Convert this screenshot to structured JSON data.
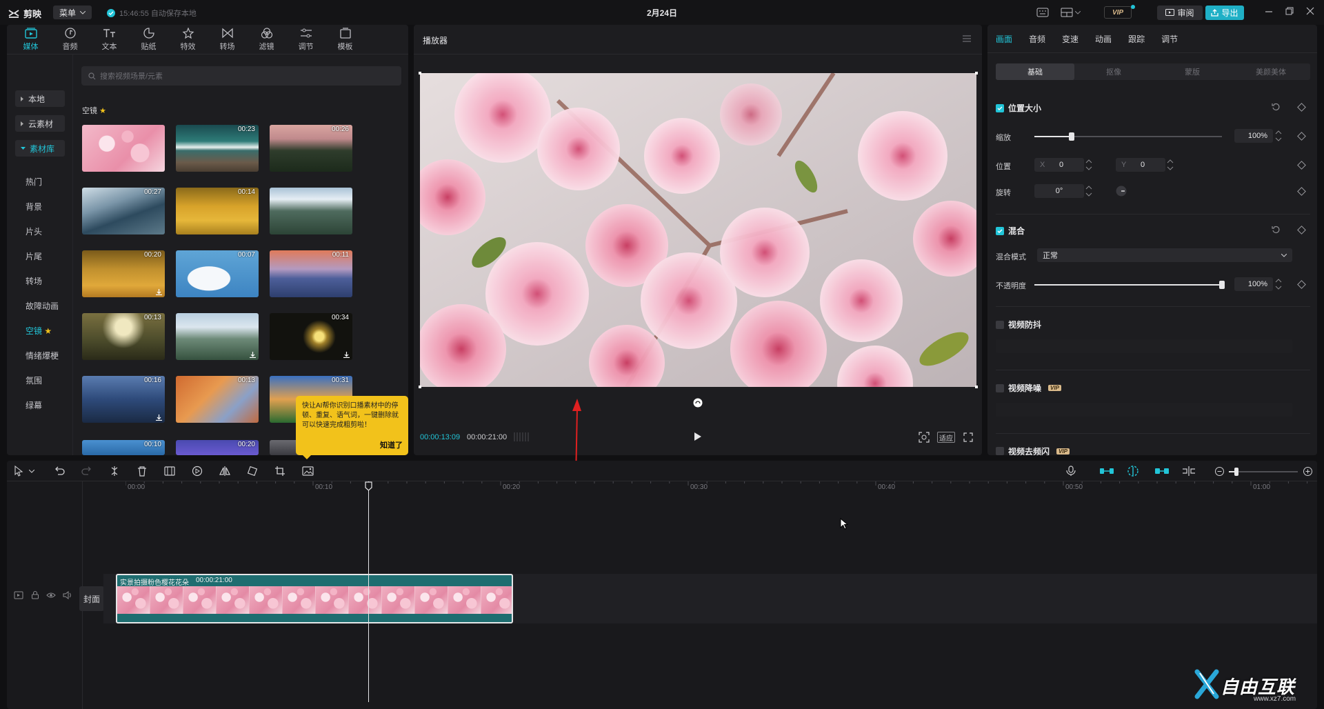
{
  "titlebar": {
    "app_name": "剪映",
    "menu_label": "菜单",
    "save_status": "15:46:55 自动保存本地",
    "date": "2月24日",
    "vip": "VIP",
    "review": "审阅",
    "export": "导出"
  },
  "media_tabs": [
    {
      "label": "媒体",
      "icon": "media-icon",
      "active": true
    },
    {
      "label": "音频",
      "icon": "audio-icon"
    },
    {
      "label": "文本",
      "icon": "text-icon"
    },
    {
      "label": "贴纸",
      "icon": "sticker-icon"
    },
    {
      "label": "特效",
      "icon": "effects-icon"
    },
    {
      "label": "转场",
      "icon": "transition-icon"
    },
    {
      "label": "滤镜",
      "icon": "filter-icon"
    },
    {
      "label": "调节",
      "icon": "adjust-icon"
    },
    {
      "label": "模板",
      "icon": "template-icon"
    }
  ],
  "sidebar": {
    "groups": [
      "本地",
      "云素材",
      "素材库"
    ],
    "items": [
      "热门",
      "背景",
      "片头",
      "片尾",
      "转场",
      "故障动画",
      "空镜",
      "情绪爆梗",
      "氛围",
      "绿幕"
    ]
  },
  "search_placeholder": "搜索视频场景/元素",
  "section_title": "空镜",
  "thumbnails": [
    {
      "dur": ""
    },
    {
      "dur": "00:23"
    },
    {
      "dur": "00:26"
    },
    {
      "dur": "00:27"
    },
    {
      "dur": "00:14"
    },
    {
      "dur": ""
    },
    {
      "dur": "00:20"
    },
    {
      "dur": "00:07"
    },
    {
      "dur": "00:11"
    },
    {
      "dur": "00:13"
    },
    {
      "dur": ""
    },
    {
      "dur": "00:34"
    },
    {
      "dur": "00:16"
    },
    {
      "dur": "00:13"
    },
    {
      "dur": "00:31"
    },
    {
      "dur": "00:10"
    },
    {
      "dur": "00:20"
    },
    {
      "dur": ""
    }
  ],
  "tooltip": {
    "text": "快让AI帮你识别口播素材中的停顿、重复、语气词，一键删除就可以快速完成粗剪啦！",
    "ok": "知道了"
  },
  "player": {
    "title": "播放器",
    "time_current": "00:00:13:09",
    "time_total": "00:00:21:00",
    "fit_label": "适应"
  },
  "props": {
    "tabs": [
      "画面",
      "音频",
      "变速",
      "动画",
      "跟踪",
      "调节"
    ],
    "segments": [
      "基础",
      "抠像",
      "蒙版",
      "美颜美体"
    ],
    "position_size": {
      "title": "位置大小",
      "scale_label": "缩放",
      "scale_value": "100%",
      "scale_fraction": 0.2,
      "position_label": "位置",
      "x_label": "X",
      "x_value": "0",
      "y_label": "Y",
      "y_value": "0",
      "rotate_label": "旋转",
      "rotate_value": "0°"
    },
    "blend": {
      "title": "混合",
      "mode_label": "混合模式",
      "mode_value": "正常",
      "opacity_label": "不透明度",
      "opacity_value": "100%",
      "opacity_fraction": 1.0
    },
    "stabilize": {
      "title": "视频防抖"
    },
    "denoise": {
      "title": "视频降噪",
      "vip": "VIP"
    },
    "deflicker": {
      "title": "视频去频闪",
      "vip": "VIP"
    }
  },
  "timeline": {
    "ruler": [
      "00:00",
      "00:10",
      "00:20",
      "00:30",
      "00:40",
      "00:50",
      "01:00"
    ],
    "cover_label": "封面",
    "clip_name": "实景拍摄粉色樱花花朵",
    "clip_duration": "00:00:21:00"
  },
  "watermark": {
    "text": "自由互联",
    "url": "www.xz7.com"
  },
  "colors": {
    "accent": "#22c5d8",
    "export": "#1fb0c6",
    "tooltip": "#f2c21b",
    "clip": "#1e6d70"
  }
}
